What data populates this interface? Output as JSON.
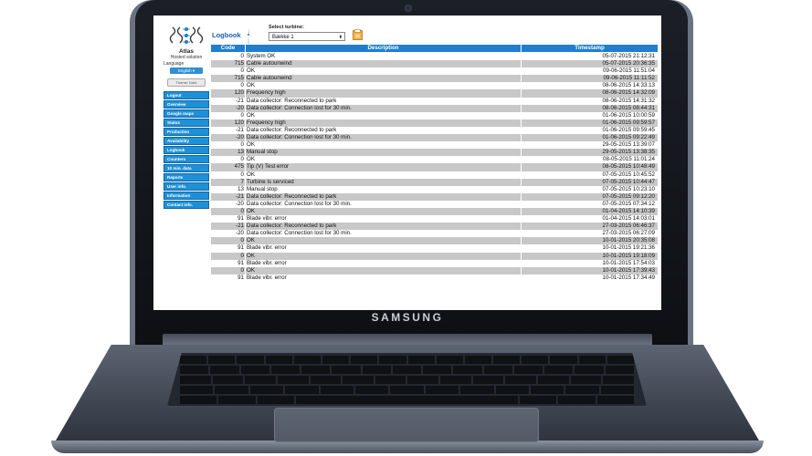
{
  "device": {
    "brand": "SAMSUNG"
  },
  "sidebar": {
    "app_name": "Atlas",
    "app_subtitle": "Hosted solution",
    "language_label": "Language",
    "language_value": "English",
    "theme_button": "Theme: Dark",
    "nav": [
      "Logout",
      "Overview",
      "Google maps",
      "Status",
      "Production",
      "Availability",
      "Logbook",
      "Counters",
      "10 min. data",
      "Reports",
      "User info.",
      "Information",
      "Contact info."
    ]
  },
  "header": {
    "page_title": "Logbook",
    "select_label": "Select turbine:",
    "selected_turbine": "Bække 1"
  },
  "table": {
    "columns": [
      "Code",
      "Description",
      "Timestamp"
    ],
    "rows": [
      [
        "0",
        "System OK",
        "05-07-2015 21:12:31"
      ],
      [
        "715",
        "Cable autounwind",
        "05-07-2015 20:36:35"
      ],
      [
        "0",
        "OK",
        "09-06-2015 11:51:04"
      ],
      [
        "715",
        "Cable autounwind",
        "09-06-2015 11:11:52"
      ],
      [
        "0",
        "OK",
        "08-06-2015 14:33:13"
      ],
      [
        "120",
        "Frequency high",
        "08-06-2015 14:32:09"
      ],
      [
        "-21",
        "Data collector: Reconnected to park",
        "08-06-2015 14:31:32"
      ],
      [
        "-20",
        "Data collector: Connection lost for 30 min.",
        "08-06-2015 08:44:31"
      ],
      [
        "0",
        "OK",
        "01-06-2015 10:00:59"
      ],
      [
        "120",
        "Frequency high",
        "01-06-2015 09:59:57"
      ],
      [
        "-21",
        "Data collector: Reconnected to park",
        "01-06-2015 09:59:45"
      ],
      [
        "-20",
        "Data collector: Connection lost for 30 min.",
        "01-06-2015 09:22:49"
      ],
      [
        "0",
        "OK",
        "29-05-2015 13:39:07"
      ],
      [
        "13",
        "Manual stop",
        "29-05-2015 13:38:35"
      ],
      [
        "0",
        "OK",
        "08-05-2015 11:01:24"
      ],
      [
        "475",
        "Tip (V) Test error",
        "08-05-2015 10:48:49"
      ],
      [
        "0",
        "OK",
        "07-05-2015 10:45:52"
      ],
      [
        "7",
        "Turbine is serviced",
        "07-05-2015 10:44:47"
      ],
      [
        "13",
        "Manual stop",
        "07-05-2015 10:23:10"
      ],
      [
        "-21",
        "Data collector: Reconnected to park",
        "07-05-2015 09:12:20"
      ],
      [
        "-20",
        "Data collector: Connection lost for 30 min.",
        "07-05-2015 07:34:12"
      ],
      [
        "0",
        "OK",
        "01-04-2015 14:10:39"
      ],
      [
        "91",
        "Blade vibr. error",
        "01-04-2015 14:03:01"
      ],
      [
        "-21",
        "Data collector: Reconnected to park",
        "27-03-2015 06:46:37"
      ],
      [
        "-20",
        "Data collector: Connection lost for 30 min.",
        "27-03-2015 06:27:09"
      ],
      [
        "0",
        "OK",
        "10-01-2015 20:35:08"
      ],
      [
        "91",
        "Blade vibr. error",
        "10-01-2015 19:21:36"
      ],
      [
        "0",
        "OK",
        "10-01-2015 19:18:09"
      ],
      [
        "91",
        "Blade vibr. error",
        "10-01-2015 17:54:03"
      ],
      [
        "0",
        "OK",
        "10-01-2015 17:39:43"
      ],
      [
        "91",
        "Blade vibr. error",
        "10-01-2015 17:34:49"
      ]
    ]
  },
  "colors": {
    "accent": "#1e7fd0",
    "row_alt": "#c8c8c8",
    "nav_bg": "#1e90d6"
  }
}
